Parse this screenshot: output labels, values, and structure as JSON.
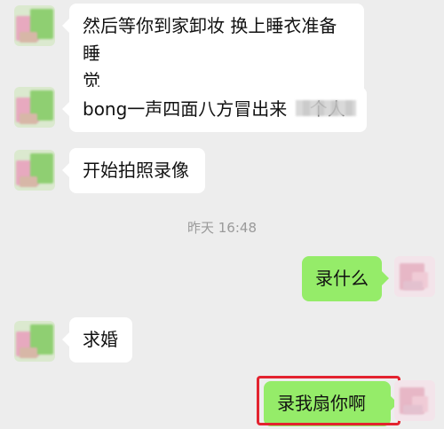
{
  "messages": [
    {
      "side": "left",
      "text": "然后等你到家卸妆 换上睡衣准备睡\n觉"
    },
    {
      "side": "left",
      "text": "bong一声四面八方冒出来    个人"
    },
    {
      "side": "left",
      "text": "开始拍照录像"
    },
    {
      "side": "right",
      "text": "录什么"
    },
    {
      "side": "left",
      "text": "求婚"
    },
    {
      "side": "right",
      "text": "录我扇你啊"
    }
  ],
  "timestamp": "昨天 16:48",
  "colors": {
    "background": "#ededed",
    "incoming_bubble": "#ffffff",
    "outgoing_bubble": "#95ec69",
    "highlight_box": "#e3232f"
  }
}
